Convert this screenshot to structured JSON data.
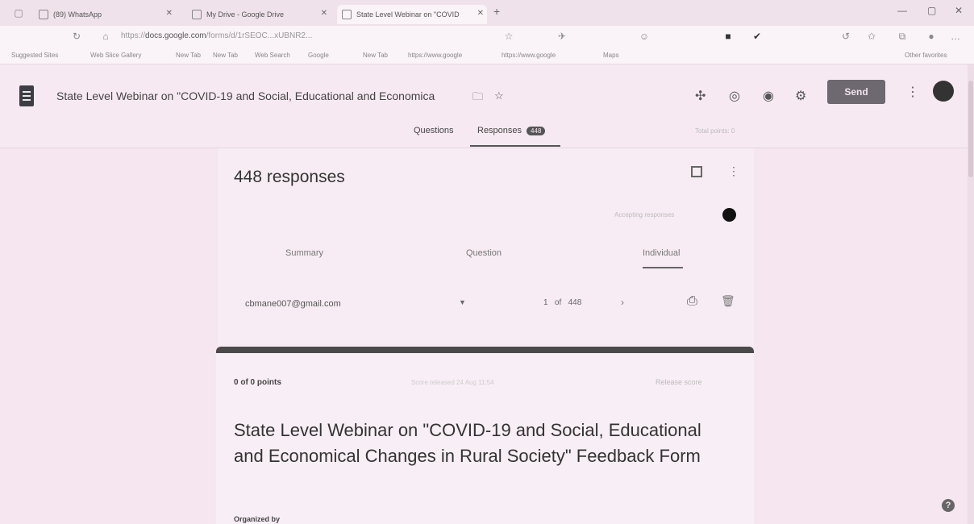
{
  "browser": {
    "tabs": [
      {
        "label": "(89) WhatsApp",
        "icon": "whatsapp-icon"
      },
      {
        "label": "My Drive - Google Drive",
        "icon": "google-drive-icon"
      },
      {
        "label": "State Level Webinar on \"COVID",
        "icon": "google-forms-icon"
      }
    ],
    "new_tab_symbol": "+",
    "url_host": "docs.google.com",
    "url_rest": "/forms/d/1rSEOC...xUBNR2...",
    "bookmarks": [
      "Suggested Sites",
      "Web Slice Gallery",
      "New Tab",
      "New Tab",
      "Web Search",
      "Google",
      "New Tab",
      "https://www.google",
      "https://www.google",
      "Maps"
    ],
    "other_favorites": "Other favorites"
  },
  "header": {
    "title": "State Level Webinar on \"COVID-19 and Social, Educational and Economica",
    "send_label": "Send"
  },
  "form_tabs": {
    "questions": "Questions",
    "responses": "Responses",
    "responses_count": "448",
    "total_points": "Total points: 0"
  },
  "responses": {
    "count_label": "448 responses",
    "accepting_label": "Accepting responses",
    "subtabs": {
      "summary": "Summary",
      "question": "Question",
      "individual": "Individual"
    },
    "respondent_email": "cbmane007@gmail.com",
    "pager": {
      "current": "1",
      "of": "of",
      "total": "448"
    }
  },
  "response": {
    "points": "0 of 0 points",
    "submitted": "Score released 24 Aug 11:54",
    "release_score": "Release score",
    "heading": "State Level Webinar on \"COVID-19 and Social, Educational and Economical Changes in Rural Society\" Feedback Form",
    "organized_by": "Organized by"
  }
}
